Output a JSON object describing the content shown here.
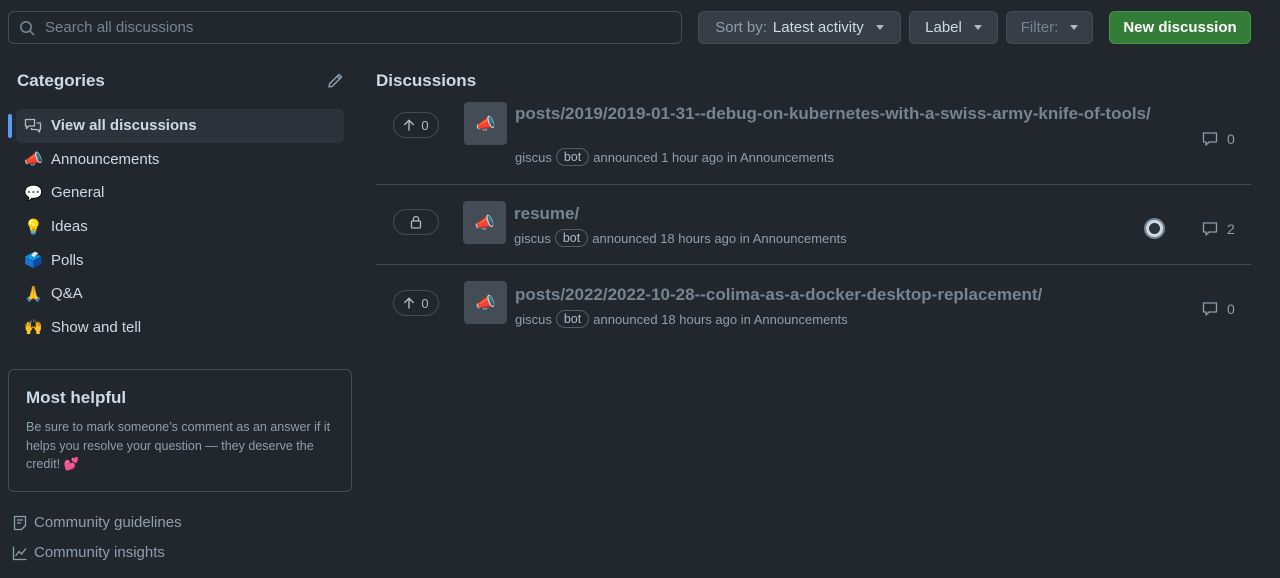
{
  "topbar": {
    "search_placeholder": "Search all discussions",
    "sort_prefix": "Sort by:",
    "sort_value": "Latest activity",
    "label_button": "Label",
    "filter_button": "Filter:",
    "new_discussion": "New discussion"
  },
  "sidebar": {
    "title": "Categories",
    "items": [
      {
        "icon": "speech-bubbles-icon",
        "emoji": "",
        "label": "View all discussions",
        "active": true
      },
      {
        "icon": "megaphone-icon",
        "emoji": "📣",
        "label": "Announcements"
      },
      {
        "icon": "speech-balloon-icon",
        "emoji": "💬",
        "label": "General"
      },
      {
        "icon": "lightbulb-icon",
        "emoji": "💡",
        "label": "Ideas"
      },
      {
        "icon": "ballot-box-icon",
        "emoji": "🗳️",
        "label": "Polls"
      },
      {
        "icon": "folded-hands-icon",
        "emoji": "🙏",
        "label": "Q&A"
      },
      {
        "icon": "raised-hands-icon",
        "emoji": "🙌",
        "label": "Show and tell"
      }
    ],
    "most_helpful": {
      "title": "Most helpful",
      "text": "Be sure to mark someone’s comment as an answer if it helps you resolve your question — they deserve the credit! 💕"
    },
    "footer": {
      "guidelines": "Community guidelines",
      "insights": "Community insights"
    }
  },
  "main": {
    "title": "Discussions",
    "discussions": [
      {
        "votes": "0",
        "locked": false,
        "thumb_emoji": "📣",
        "title": "posts/2019/2019-01-31--debug-on-kubernetes-with-a-swiss-army-knife-of-tools/",
        "author": "giscus",
        "badge": "bot",
        "meta": "announced 1 hour ago in Announcements",
        "comments": "0"
      },
      {
        "votes": "",
        "locked": true,
        "thumb_emoji": "📣",
        "title": "resume/",
        "author": "giscus",
        "badge": "bot",
        "meta": "announced 18 hours ago in Announcements",
        "comments": "2"
      },
      {
        "votes": "0",
        "locked": false,
        "thumb_emoji": "📣",
        "title": "posts/2022/2022-10-28--colima-as-a-docker-desktop-replacement/",
        "author": "giscus",
        "badge": "bot",
        "meta": "announced 18 hours ago in Announcements",
        "comments": "0"
      }
    ]
  },
  "colors": {
    "background": "#22272e",
    "accent": "#539bf5",
    "primary_button": "#347d39"
  }
}
